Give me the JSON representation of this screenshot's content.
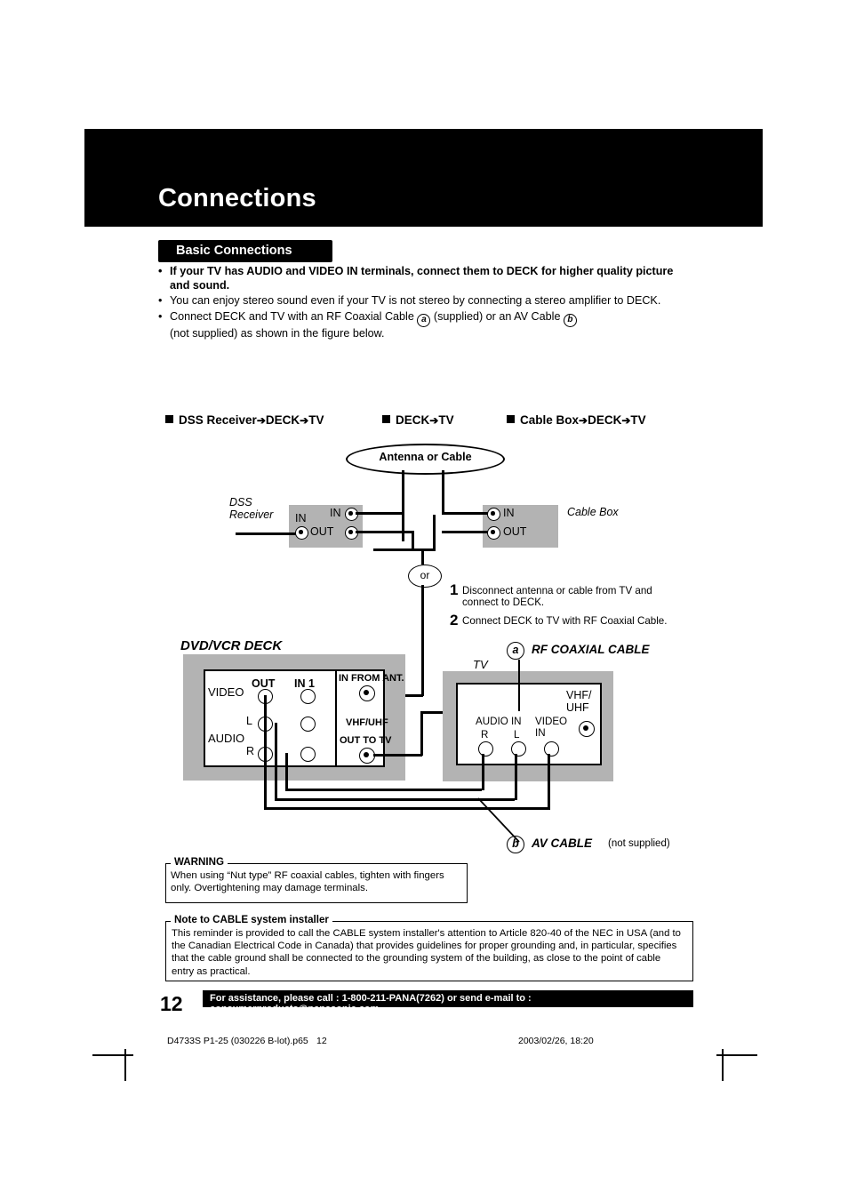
{
  "header": {
    "title": "Connections"
  },
  "section": {
    "label": "Basic Connections"
  },
  "bullets": [
    {
      "text": "If your TV has AUDIO and VIDEO IN terminals, connect them to DECK for higher quality picture and sound.",
      "bold": true
    },
    {
      "text": "You can enjoy stereo sound even if your TV is not stereo by connecting a stereo amplifier to DECK.",
      "bold": false
    }
  ],
  "bullet3": {
    "part1": "Connect DECK and TV with an RF Coaxial Cable",
    "mark_a": "a",
    "part2": "(supplied) or an AV Cable",
    "mark_b": "b",
    "part3": "(not supplied) as shown in the figure below."
  },
  "diagram_headers": [
    {
      "text": "DSS Receiver",
      "arrow1": "➔",
      "mid": "DECK",
      "arrow2": "➔",
      "end": "TV"
    },
    {
      "text": "DECK",
      "arrow1": "➔",
      "mid": "TV",
      "arrow2": "",
      "end": ""
    },
    {
      "text": "Cable Box",
      "arrow1": "➔",
      "mid": "DECK",
      "arrow2": "➔",
      "end": "TV"
    }
  ],
  "diagram": {
    "antenna_oval": "Antenna or Cable",
    "dss_receiver": "DSS\nReceiver",
    "dss_in_left": "IN",
    "dss_in": "IN",
    "dss_out": "OUT",
    "cable_box_in": "IN",
    "cable_box_out": "OUT",
    "cable_box_label": "Cable Box",
    "or": "or",
    "step1_num": "1",
    "step1_text": "Disconnect antenna or cable from TV and connect to DECK.",
    "step2_num": "2",
    "step2_text": "Connect DECK to TV with RF Coaxial Cable.",
    "deck_title": "DVD/VCR DECK",
    "deck_video": "VIDEO",
    "deck_audio": "AUDIO",
    "deck_out": "OUT",
    "deck_in1": "IN 1",
    "deck_l": "L",
    "deck_r": "R",
    "deck_in_from_ant": "IN FROM ANT.",
    "deck_vhf_uhf": "VHF/UHF",
    "deck_out_to_tv": "OUT TO TV",
    "tv_label": "TV",
    "tv_vhf_uhf": "VHF/\nUHF",
    "tv_audio_in": "AUDIO IN",
    "tv_video_in": "VIDEO\nIN",
    "tv_r": "R",
    "tv_l": "L",
    "mark_a": "a",
    "rf_cable_label": "RF COAXIAL CABLE",
    "mark_b": "b",
    "av_cable_label": "AV CABLE",
    "av_cable_note": "(not supplied)"
  },
  "warning": {
    "title": "WARNING",
    "body": "When using “Nut type” RF coaxial cables, tighten with fingers only. Overtightening may damage terminals."
  },
  "note": {
    "title": "Note to CABLE system installer",
    "body": "This reminder is provided to call the CABLE system installer's attention to Article 820-40 of the NEC in USA (and to the Canadian Electrical Code in Canada) that provides guidelines for proper grounding and, in particular, specifies that the cable ground shall be connected to the grounding system of the building, as close to the point of cable entry as practical."
  },
  "footer": {
    "page_number": "12",
    "assistance": "For assistance, please call : 1-800-211-PANA(7262) or send e-mail to : consumerproducts@panasonic.com",
    "file": "D4733S P1-25 (030226 B-lot).p65",
    "page": "12",
    "date": "2003/02/26, 18:20"
  }
}
